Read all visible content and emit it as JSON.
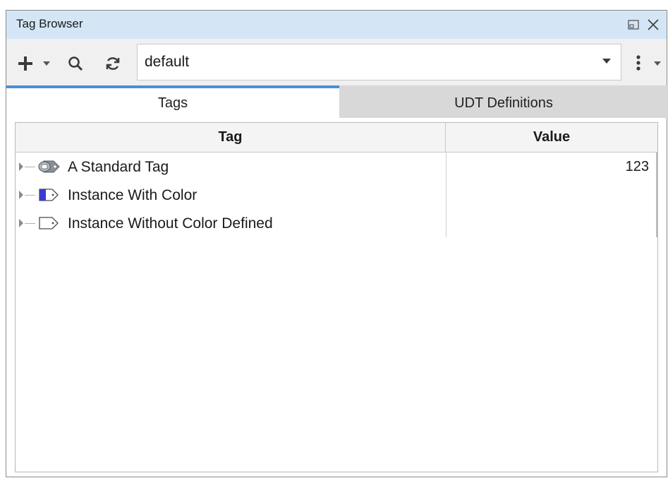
{
  "window": {
    "title": "Tag Browser"
  },
  "toolbar": {
    "provider_value": "default",
    "icons": [
      "add-icon",
      "dropdown-caret-icon",
      "search-icon",
      "refresh-icon",
      "more-options-icon"
    ]
  },
  "tabs": [
    {
      "label": "Tags",
      "active": true
    },
    {
      "label": "UDT Definitions",
      "active": false
    }
  ],
  "table": {
    "columns": [
      "Tag",
      "Value"
    ],
    "rows": [
      {
        "name": "A Standard Tag",
        "value": "123",
        "icon": "standard-tag-icon"
      },
      {
        "name": "Instance With Color",
        "value": "",
        "icon": "colored-udt-instance-icon"
      },
      {
        "name": "Instance Without Color Defined",
        "value": "",
        "icon": "udt-instance-icon"
      }
    ]
  },
  "colors": {
    "title_bar": "#d4e6f6",
    "active_tab_accent": "#4a90d9",
    "instance_color": "#3a3ad6"
  }
}
